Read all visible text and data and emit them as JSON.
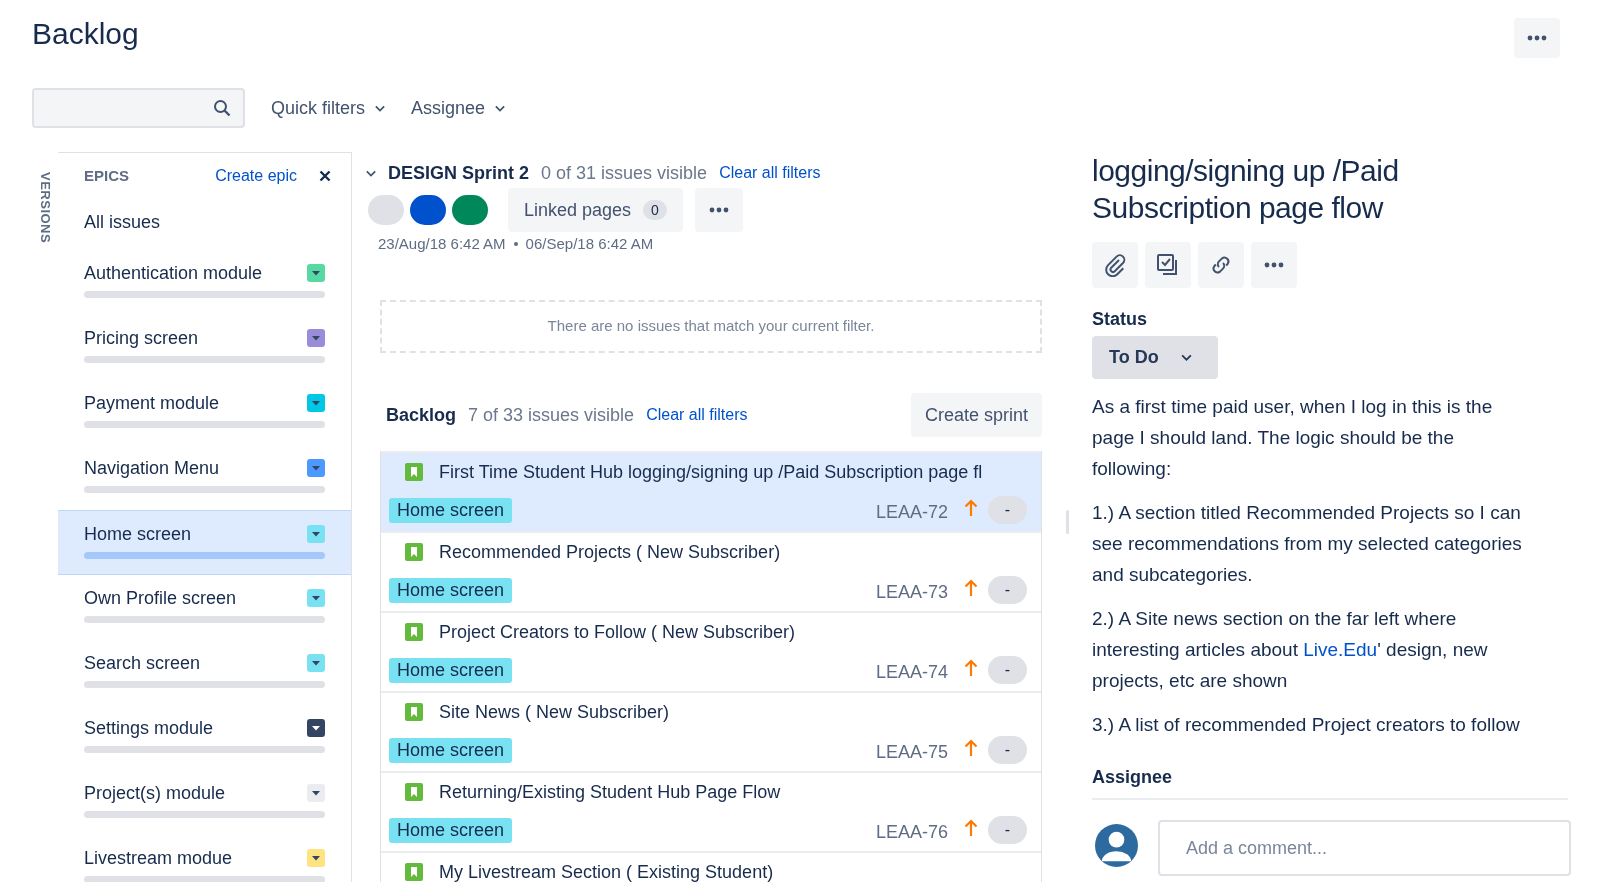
{
  "page_title": "Backlog",
  "filters": [
    {
      "label": "Quick filters"
    },
    {
      "label": "Assignee"
    }
  ],
  "versions_tab": "VERSIONS",
  "epics_panel": {
    "heading": "EPICS",
    "create_link": "Create epic",
    "all_issues": "All issues",
    "items": [
      {
        "name": "Authentication module",
        "color": "#57d9a3",
        "selected": false
      },
      {
        "name": "Pricing screen",
        "color": "#998dd9",
        "selected": false
      },
      {
        "name": "Payment module",
        "color": "#00c7e6",
        "selected": false
      },
      {
        "name": "Navigation Menu",
        "color": "#4c9aff",
        "selected": false
      },
      {
        "name": "Home screen",
        "color": "#79e2f2",
        "selected": true
      },
      {
        "name": "Own Profile screen",
        "color": "#79e2f2",
        "selected": false
      },
      {
        "name": "Search screen",
        "color": "#79e2f2",
        "selected": false
      },
      {
        "name": "Settings module",
        "color": "#344563",
        "selected": false
      },
      {
        "name": "Project(s) module",
        "color": "#ebecf0",
        "selected": false
      },
      {
        "name": "Livestream modue",
        "color": "#ffe380",
        "selected": false
      }
    ]
  },
  "sprint": {
    "name": "DESIGN Sprint 2",
    "visible": "0 of 31 issues visible",
    "clear_link": "Clear all filters",
    "status_counts": [
      {
        "color": "#dfe1e6"
      },
      {
        "color": "#0052cc"
      },
      {
        "color": "#00875a"
      }
    ],
    "linked_pages": {
      "label": "Linked pages",
      "count": "0"
    },
    "start": "23/Aug/18 6:42 AM",
    "end": "06/Sep/18 6:42 AM",
    "empty_message": "There are no issues that match your current filter."
  },
  "backlog": {
    "name": "Backlog",
    "visible": "7 of 33 issues visible",
    "clear_link": "Clear all filters",
    "create_sprint": "Create sprint",
    "issues": [
      {
        "summary": "First Time Student Hub logging/signing up /Paid Subscription page fl",
        "epic": "Home screen",
        "key": "LEAA-72",
        "estimate": "-",
        "selected": true
      },
      {
        "summary": "Recommended Projects ( New Subscriber)",
        "epic": "Home screen",
        "key": "LEAA-73",
        "estimate": "-",
        "selected": false
      },
      {
        "summary": "Project Creators to Follow ( New Subscriber)",
        "epic": "Home screen",
        "key": "LEAA-74",
        "estimate": "-",
        "selected": false
      },
      {
        "summary": "Site News ( New Subscriber)",
        "epic": "Home screen",
        "key": "LEAA-75",
        "estimate": "-",
        "selected": false
      },
      {
        "summary": "Returning/Existing Student Hub Page Flow",
        "epic": "Home screen",
        "key": "LEAA-76",
        "estimate": "-",
        "selected": false
      },
      {
        "summary": "My Livestream Section ( Existing Student)",
        "selected": false
      }
    ]
  },
  "detail": {
    "title": "logging/signing up /Paid Subscription page flow",
    "status_label": "Status",
    "status": "To Do",
    "description": [
      {
        "text": "As a first time paid user, when I log in this is the page I should land. The logic should be the following:"
      },
      {
        "text": "1.) A section titled Recommended Projects so I can see recommendations from my selected categories and subcategories."
      },
      {
        "before": "2.) A Site news section on the far left where interesting articles about ",
        "link": "Live.Edu",
        "after": "' design, new projects, etc are shown"
      },
      {
        "text": "3.) A list of recommended Project creators to follow"
      }
    ],
    "assignee_label": "Assignee",
    "comment_placeholder": "Add a comment..."
  }
}
